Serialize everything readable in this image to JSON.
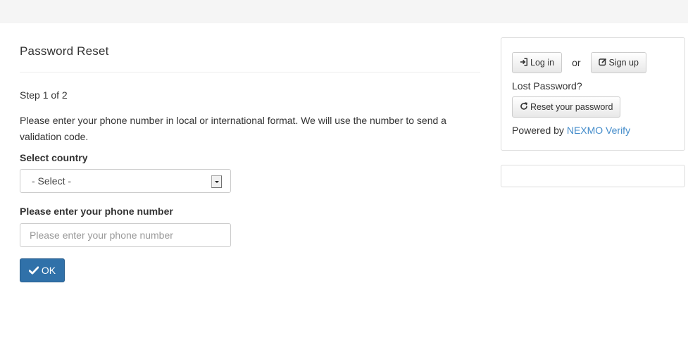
{
  "main": {
    "title": "Password Reset",
    "step": "Step 1 of 2",
    "intro": "Please enter your phone number in local or international format. We will use the number to send a validation code.",
    "country_label": "Select country",
    "country_value": "- Select -",
    "phone_label": "Please enter your phone number",
    "phone_placeholder": "Please enter your phone number",
    "phone_value": "",
    "ok_label": "OK"
  },
  "sidebar": {
    "login_label": "Log in",
    "or_text": "or",
    "signup_label": "Sign up",
    "lost_password_text": "Lost Password?",
    "reset_label": "Reset your password",
    "powered_by_text": "Powered by",
    "powered_by_link": "NEXMO Verify"
  },
  "icons": {
    "ok": "check-icon",
    "login": "sign-in-icon",
    "signup": "edit-icon",
    "reset": "refresh-icon"
  },
  "colors": {
    "primary": "#3071a9",
    "link": "#428bca",
    "topbar": "#f5f5f5"
  }
}
